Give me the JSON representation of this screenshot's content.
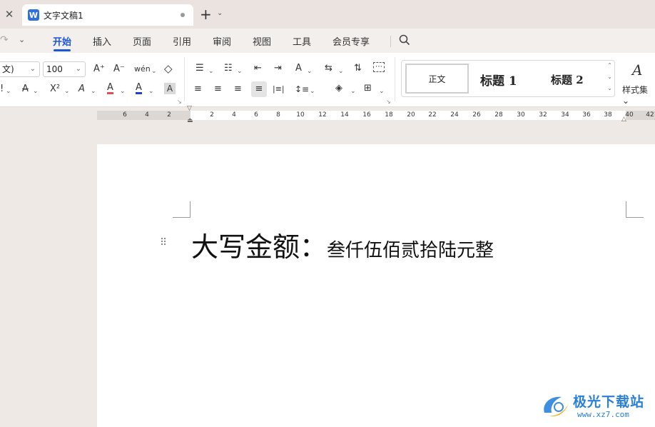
{
  "tabs": {
    "document_title": "文字文稿1",
    "app_badge": "W",
    "close_glyph": "✕",
    "new_tab_glyph": "+",
    "new_tab_menu_glyph": "⌄"
  },
  "menu": {
    "items": [
      {
        "label": "开始",
        "active": true
      },
      {
        "label": "插入"
      },
      {
        "label": "页面"
      },
      {
        "label": "引用"
      },
      {
        "label": "审阅"
      },
      {
        "label": "视图"
      },
      {
        "label": "工具"
      },
      {
        "label": "会员专享"
      }
    ],
    "redo_glyph": "↷",
    "quick_menu_glyph": "⌄"
  },
  "ribbon": {
    "font_name": "文)",
    "font_size": "100",
    "row1": {
      "grow_font": "A⁺",
      "shrink_font": "A⁻",
      "phonetic": "wén",
      "clear_format": "◇",
      "bullets": "☰",
      "numbering": "☷",
      "decrease_indent": "⇤",
      "increase_indent": "⇥",
      "text_direction": "A",
      "chinese_layout": "⇆",
      "sort": "⇅",
      "show_marks": "⋯"
    },
    "row2": {
      "underline": "!",
      "strikethrough": "A",
      "superscript": "X²",
      "text_effect": "A",
      "highlight": "A",
      "font_color": "A",
      "char_shading": "A",
      "align_left": "≡",
      "align_center": "≡",
      "align_right": "≡",
      "justify": "≡",
      "distribute": "|≡|",
      "line_spacing": "↕≡",
      "shading": "◈",
      "borders": "⊞"
    },
    "styles": {
      "normal": "正文",
      "heading1": "标题 1",
      "heading2": "标题 2",
      "style_set_label": "样式集"
    },
    "colors": {
      "accent": "#1a56d6",
      "font_color_bar": "#1f3fd6",
      "highlight_bar": "#e05050"
    }
  },
  "ruler": {
    "left_labels": [
      "6",
      "4",
      "2"
    ],
    "right_labels": [
      "2",
      "4",
      "6",
      "8",
      "10",
      "12",
      "14",
      "16",
      "18",
      "20",
      "22",
      "24",
      "26",
      "28",
      "30",
      "32",
      "34",
      "36",
      "38",
      "40",
      "42"
    ]
  },
  "document": {
    "label": "大写金额：",
    "value": "叁仟伍佰贰拾陆元整"
  },
  "watermark": {
    "name": "极光下载站",
    "url": "www.xz7.com"
  }
}
